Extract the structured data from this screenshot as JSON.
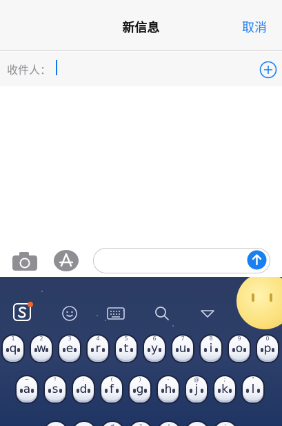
{
  "nav": {
    "title": "新信息",
    "cancel_label": "取消"
  },
  "recipient": {
    "label": "收件人：",
    "value": ""
  },
  "keyboard": {
    "row1": [
      {
        "label": "q",
        "hint": "1"
      },
      {
        "label": "w",
        "hint": "2"
      },
      {
        "label": "e",
        "hint": "3"
      },
      {
        "label": "r",
        "hint": "4"
      },
      {
        "label": "t",
        "hint": "5"
      },
      {
        "label": "y",
        "hint": "6"
      },
      {
        "label": "u",
        "hint": "7"
      },
      {
        "label": "i",
        "hint": "8"
      },
      {
        "label": "o",
        "hint": "9"
      },
      {
        "label": "p",
        "hint": "0"
      }
    ],
    "row2": [
      {
        "label": "a",
        "hint": "~"
      },
      {
        "label": "s",
        "hint": "!"
      },
      {
        "label": "d",
        "hint": ":"
      },
      {
        "label": "f",
        "hint": "("
      },
      {
        "label": "g",
        "hint": ")"
      },
      {
        "label": "h",
        "hint": "-"
      },
      {
        "label": "j",
        "hint": "@"
      },
      {
        "label": "k",
        "hint": ";"
      },
      {
        "label": "l",
        "hint": "\""
      }
    ],
    "row3_hints": [
      "",
      "",
      "#",
      "?",
      "!",
      "",
      "'"
    ]
  },
  "icons": {
    "add_recipient": "plus-circle-icon",
    "camera": "camera-icon",
    "appstore": "app-store-icon",
    "send": "arrow-up-icon",
    "sogou": "sogou-logo-icon",
    "emoji": "emoji-icon",
    "keyboard": "keyboard-icon",
    "search": "search-icon",
    "collapse": "chevron-down-icon"
  },
  "colors": {
    "accent": "#1a80f0",
    "keyboard_bg": "#2c3c63",
    "moon": "#fbe07a"
  }
}
